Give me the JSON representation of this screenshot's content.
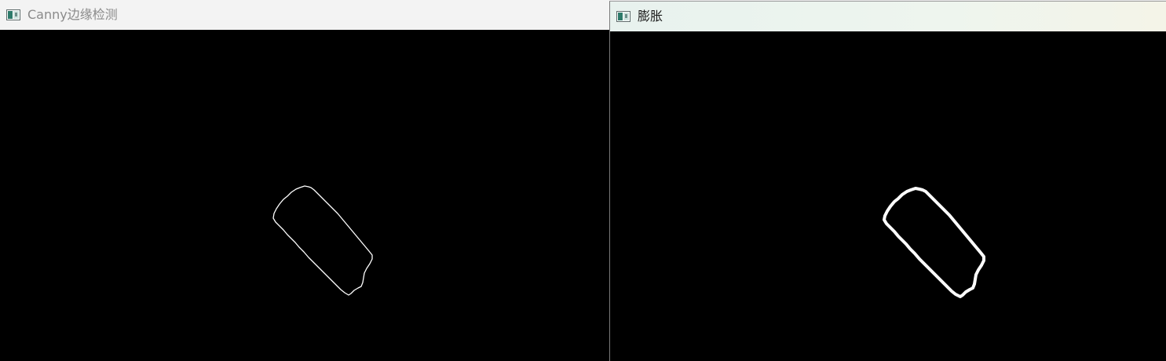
{
  "windows": {
    "canny": {
      "title": "Canny边缘检测",
      "icon": "opencv-window-icon",
      "image": "edge-contour-thin"
    },
    "dilate": {
      "title": "膨胀",
      "icon": "opencv-window-icon",
      "image": "edge-contour-thick"
    }
  },
  "colors": {
    "canvas_background": "#000000",
    "edge_color": "#ffffff"
  }
}
